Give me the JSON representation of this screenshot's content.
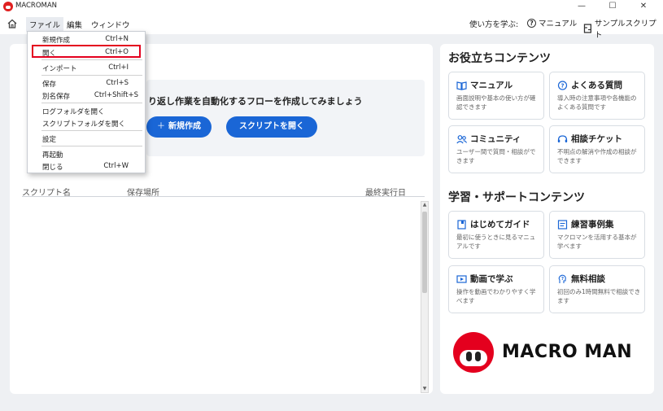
{
  "window": {
    "title": "MACROMAN",
    "controls": {
      "minimize": "—",
      "maximize": "☐",
      "close": "✕"
    }
  },
  "menubar": {
    "items": [
      {
        "label": "ファイル"
      },
      {
        "label": "編集"
      },
      {
        "label": "ウィンドウ"
      }
    ],
    "help_label": "使い方を学ぶ:",
    "manual_link": "マニュアル",
    "sample_link": "サンプルスクリプト"
  },
  "file_menu": {
    "items": [
      {
        "label": "新規作成",
        "shortcut": "Ctrl+N"
      },
      {
        "label": "開く",
        "shortcut": "Ctrl+O",
        "highlighted": true
      },
      {
        "label": "インポート",
        "shortcut": "Ctrl+I"
      },
      {
        "label": "保存",
        "shortcut": "Ctrl+S"
      },
      {
        "label": "別名保存",
        "shortcut": "Ctrl+Shift+S"
      },
      {
        "label": "ログフォルダを開く",
        "shortcut": ""
      },
      {
        "label": "スクリプトフォルダを開く",
        "shortcut": ""
      },
      {
        "label": "設定",
        "shortcut": ""
      },
      {
        "label": "再起動",
        "shortcut": ""
      },
      {
        "label": "閉じる",
        "shortcut": "Ctrl+W"
      }
    ],
    "highlight_color": "#e4001e"
  },
  "main": {
    "intro_text": "り返し作業を自動化するフローを作成してみましょう",
    "new_button": "新規作成",
    "open_script_button": "スクリプトを開く",
    "table": {
      "columns": [
        "スクリプト名",
        "保存場所",
        "最終実行日"
      ],
      "rows": []
    }
  },
  "sidebar": {
    "useful_title": "お役立ちコンテンツ",
    "useful_cards": [
      {
        "icon": "book-icon",
        "title": "マニュアル",
        "desc": "画面説明や基本の使い方が確認できます"
      },
      {
        "icon": "question-icon",
        "title": "よくある質問",
        "desc": "導入時の注意事項や各機能のよくある質問です"
      },
      {
        "icon": "users-icon",
        "title": "コミュニティ",
        "desc": "ユーザー間で質問・相談ができます"
      },
      {
        "icon": "chat-icon",
        "title": "相談チケット",
        "desc": "不明点の解消や作成の相談ができます"
      }
    ],
    "learning_title": "学習・サポートコンテンツ",
    "learning_cards": [
      {
        "icon": "guide-icon",
        "title": "はじめてガイド",
        "desc": "最初に使うときに見るマニュアルです"
      },
      {
        "icon": "list-icon",
        "title": "練習事例集",
        "desc": "マクロマンを活用する基本が学べます"
      },
      {
        "icon": "video-icon",
        "title": "動画で学ぶ",
        "desc": "操作を動画でわかりやすく学べます"
      },
      {
        "icon": "consult-icon",
        "title": "無料相談",
        "desc": "初回のみ1時間無料で相談できます"
      }
    ],
    "brand_name": "MACRO MAN"
  },
  "colors": {
    "accent": "#1a66d6",
    "brand_red": "#e4001e"
  }
}
